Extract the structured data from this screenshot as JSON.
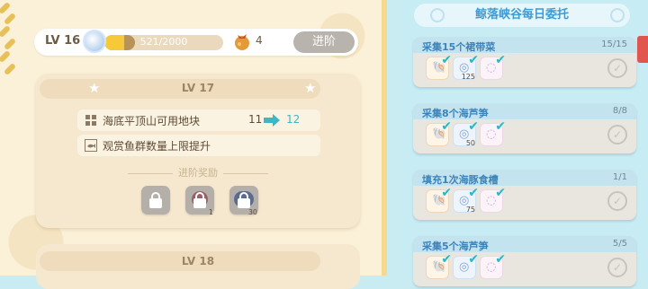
{
  "header": {
    "level_label": "LV 16",
    "xp_text": "521/2000",
    "xp_fraction": 0.2605,
    "bag_count": "4",
    "advance_button": "进阶"
  },
  "card": {
    "title": "LV 17",
    "perks": [
      {
        "icon": "grid-icon",
        "text": "海底平顶山可用地块",
        "from": "11",
        "to": "12"
      },
      {
        "icon": "fish-icon",
        "text": "观赏鱼群数量上限提升"
      }
    ],
    "reward_label": "进阶奖励",
    "rewards": [
      {
        "icon": "lock-icon",
        "qty": ""
      },
      {
        "icon": "lock-icon",
        "qty": "1"
      },
      {
        "icon": "lock-icon",
        "qty": "30"
      }
    ]
  },
  "next_card": {
    "title": "LV 18"
  },
  "commissions": {
    "title": "鲸落峡谷每日委托",
    "tasks": [
      {
        "name": "采集15个裙带菜",
        "progress": "15/15",
        "items": [
          {
            "qty": ""
          },
          {
            "qty": "125"
          },
          {
            "qty": ""
          }
        ]
      },
      {
        "name": "采集8个海芦笋",
        "progress": "8/8",
        "items": [
          {
            "qty": ""
          },
          {
            "qty": "50"
          },
          {
            "qty": ""
          }
        ]
      },
      {
        "name": "填充1次海豚食槽",
        "progress": "1/1",
        "items": [
          {
            "qty": ""
          },
          {
            "qty": "75"
          },
          {
            "qty": ""
          }
        ]
      },
      {
        "name": "采集5个海芦笋",
        "progress": "5/5",
        "items": [
          {
            "qty": ""
          },
          {
            "qty": ""
          },
          {
            "qty": ""
          }
        ]
      }
    ]
  }
}
